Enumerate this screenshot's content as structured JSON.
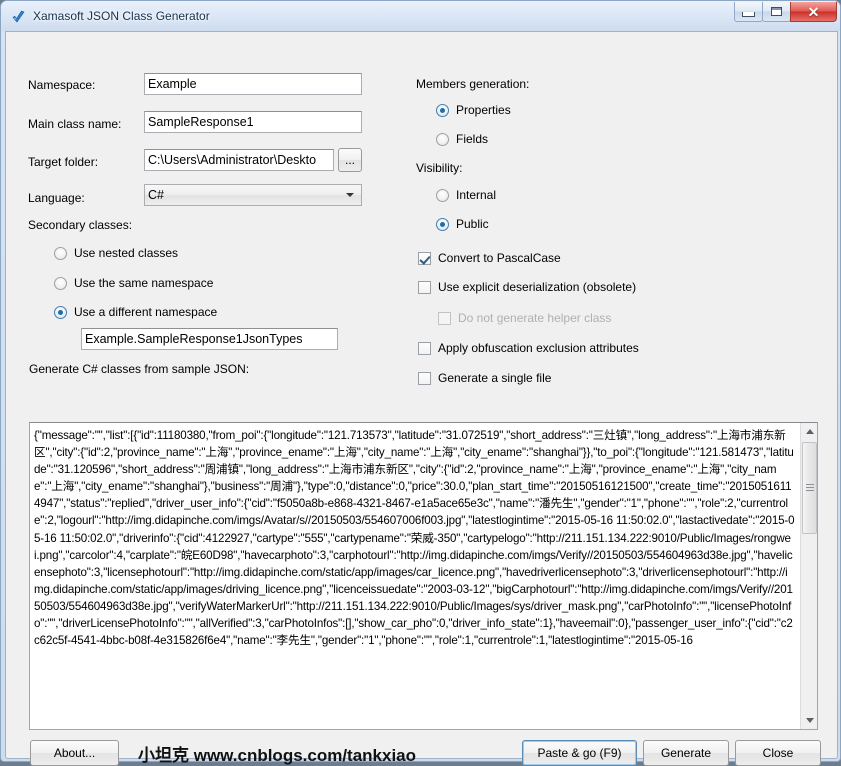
{
  "window": {
    "title": "Xamasoft JSON Class Generator",
    "icon": "app-diamond-icon",
    "minimize_label": "Minimize",
    "maximize_label": "Maximize",
    "close_glyph": "✕"
  },
  "form": {
    "namespace_label": "Namespace:",
    "namespace_value": "Example",
    "main_class_label": "Main class name:",
    "main_class_value": "SampleResponse1",
    "target_folder_label": "Target folder:",
    "target_folder_value": "C:\\Users\\Administrator\\Deskto",
    "browse_label": "...",
    "language_label": "Language:",
    "language_value": "C#",
    "secondary_classes_label": "Secondary classes:",
    "secondary_options": [
      {
        "label": "Use nested classes",
        "selected": false
      },
      {
        "label": "Use the same namespace",
        "selected": false
      },
      {
        "label": "Use a different namespace",
        "selected": true
      }
    ],
    "different_namespace_value": "Example.SampleResponse1JsonTypes"
  },
  "options": {
    "members_generation_label": "Members generation:",
    "members_options": [
      {
        "label": "Properties",
        "selected": true
      },
      {
        "label": "Fields",
        "selected": false
      }
    ],
    "visibility_label": "Visibility:",
    "visibility_options": [
      {
        "label": "Internal",
        "selected": false
      },
      {
        "label": "Public",
        "selected": true
      }
    ],
    "checkboxes": [
      {
        "label": "Convert to PascalCase",
        "checked": true,
        "enabled": true
      },
      {
        "label": "Use explicit deserialization (obsolete)",
        "checked": false,
        "enabled": true
      },
      {
        "label": "Do not generate helper class",
        "checked": false,
        "enabled": false
      },
      {
        "label": "Apply obfuscation exclusion attributes",
        "checked": false,
        "enabled": true
      },
      {
        "label": "Generate a single file",
        "checked": false,
        "enabled": true
      }
    ]
  },
  "json_section": {
    "label": "Generate C# classes from sample JSON:",
    "content": "{\"message\":\"\",\"list\":[{\"id\":11180380,\"from_poi\":{\"longitude\":\"121.713573\",\"latitude\":\"31.072519\",\"short_address\":\"三灶镇\",\"long_address\":\"上海市浦东新区\",\"city\":{\"id\":2,\"province_name\":\"上海\",\"province_ename\":\"上海\",\"city_name\":\"上海\",\"city_ename\":\"shanghai\"}},\"to_poi\":{\"longitude\":\"121.581473\",\"latitude\":\"31.120596\",\"short_address\":\"周浦镇\",\"long_address\":\"上海市浦东新区\",\"city\":{\"id\":2,\"province_name\":\"上海\",\"province_ename\":\"上海\",\"city_name\":\"上海\",\"city_ename\":\"shanghai\"},\"business\":\"周浦\"},\"type\":0,\"distance\":0,\"price\":30.0,\"plan_start_time\":\"20150516121500\",\"create_time\":\"20150516114947\",\"status\":\"replied\",\"driver_user_info\":{\"cid\":\"f5050a8b-e868-4321-8467-e1a5ace65e3c\",\"name\":\"潘先生\",\"gender\":\"1\",\"phone\":\"\",\"role\":2,\"currentrole\":2,\"logourl\":\"http://img.didapinche.com/imgs/Avatar/s//20150503/554607006f003.jpg\",\"latestlogintime\":\"2015-05-16 11:50:02.0\",\"lastactivedate\":\"2015-05-16 11:50:02.0\",\"driverinfo\":{\"cid\":4122927,\"cartype\":\"555\",\"cartypename\":\"荣威-350\",\"cartypelogo\":\"http://211.151.134.222:9010/Public/Images/rongwei.png\",\"carcolor\":4,\"carplate\":\"皖E60D98\",\"havecarphoto\":3,\"carphotourl\":\"http://img.didapinche.com/imgs/Verify//20150503/554604963d38e.jpg\",\"havelicensephoto\":3,\"licensephotourl\":\"http://img.didapinche.com/static/app/images/car_licence.png\",\"havedriverlicensephoto\":3,\"driverlicensephotourl\":\"http://img.didapinche.com/static/app/images/driving_licence.png\",\"licenceissuedate\":\"2003-03-12\",\"bigCarphotourl\":\"http://img.didapinche.com/imgs/Verify//20150503/554604963d38e.jpg\",\"verifyWaterMarkerUrl\":\"http://211.151.134.222:9010/Public/Images/sys/driver_mask.png\",\"carPhotoInfo\":\"\",\"licensePhotoInfo\":\"\",\"driverLicensePhotoInfo\":\"\",\"allVerified\":3,\"carPhotoInfos\":[],\"show_car_pho\":0,\"driver_info_state\":1},\"haveemail\":0},\"passenger_user_info\":{\"cid\":\"c2c62c5f-4541-4bbc-b08f-4e315826f6e4\",\"name\":\"李先生\",\"gender\":\"1\",\"phone\":\"\",\"role\":1,\"currentrole\":1,\"latestlogintime\":\"2015-05-16"
  },
  "footer": {
    "about_label": "About...",
    "watermark": "小坦克 www.cnblogs.com/tankxiao",
    "paste_go_label": "Paste & go (F9)",
    "generate_label": "Generate",
    "close_label": "Close"
  }
}
